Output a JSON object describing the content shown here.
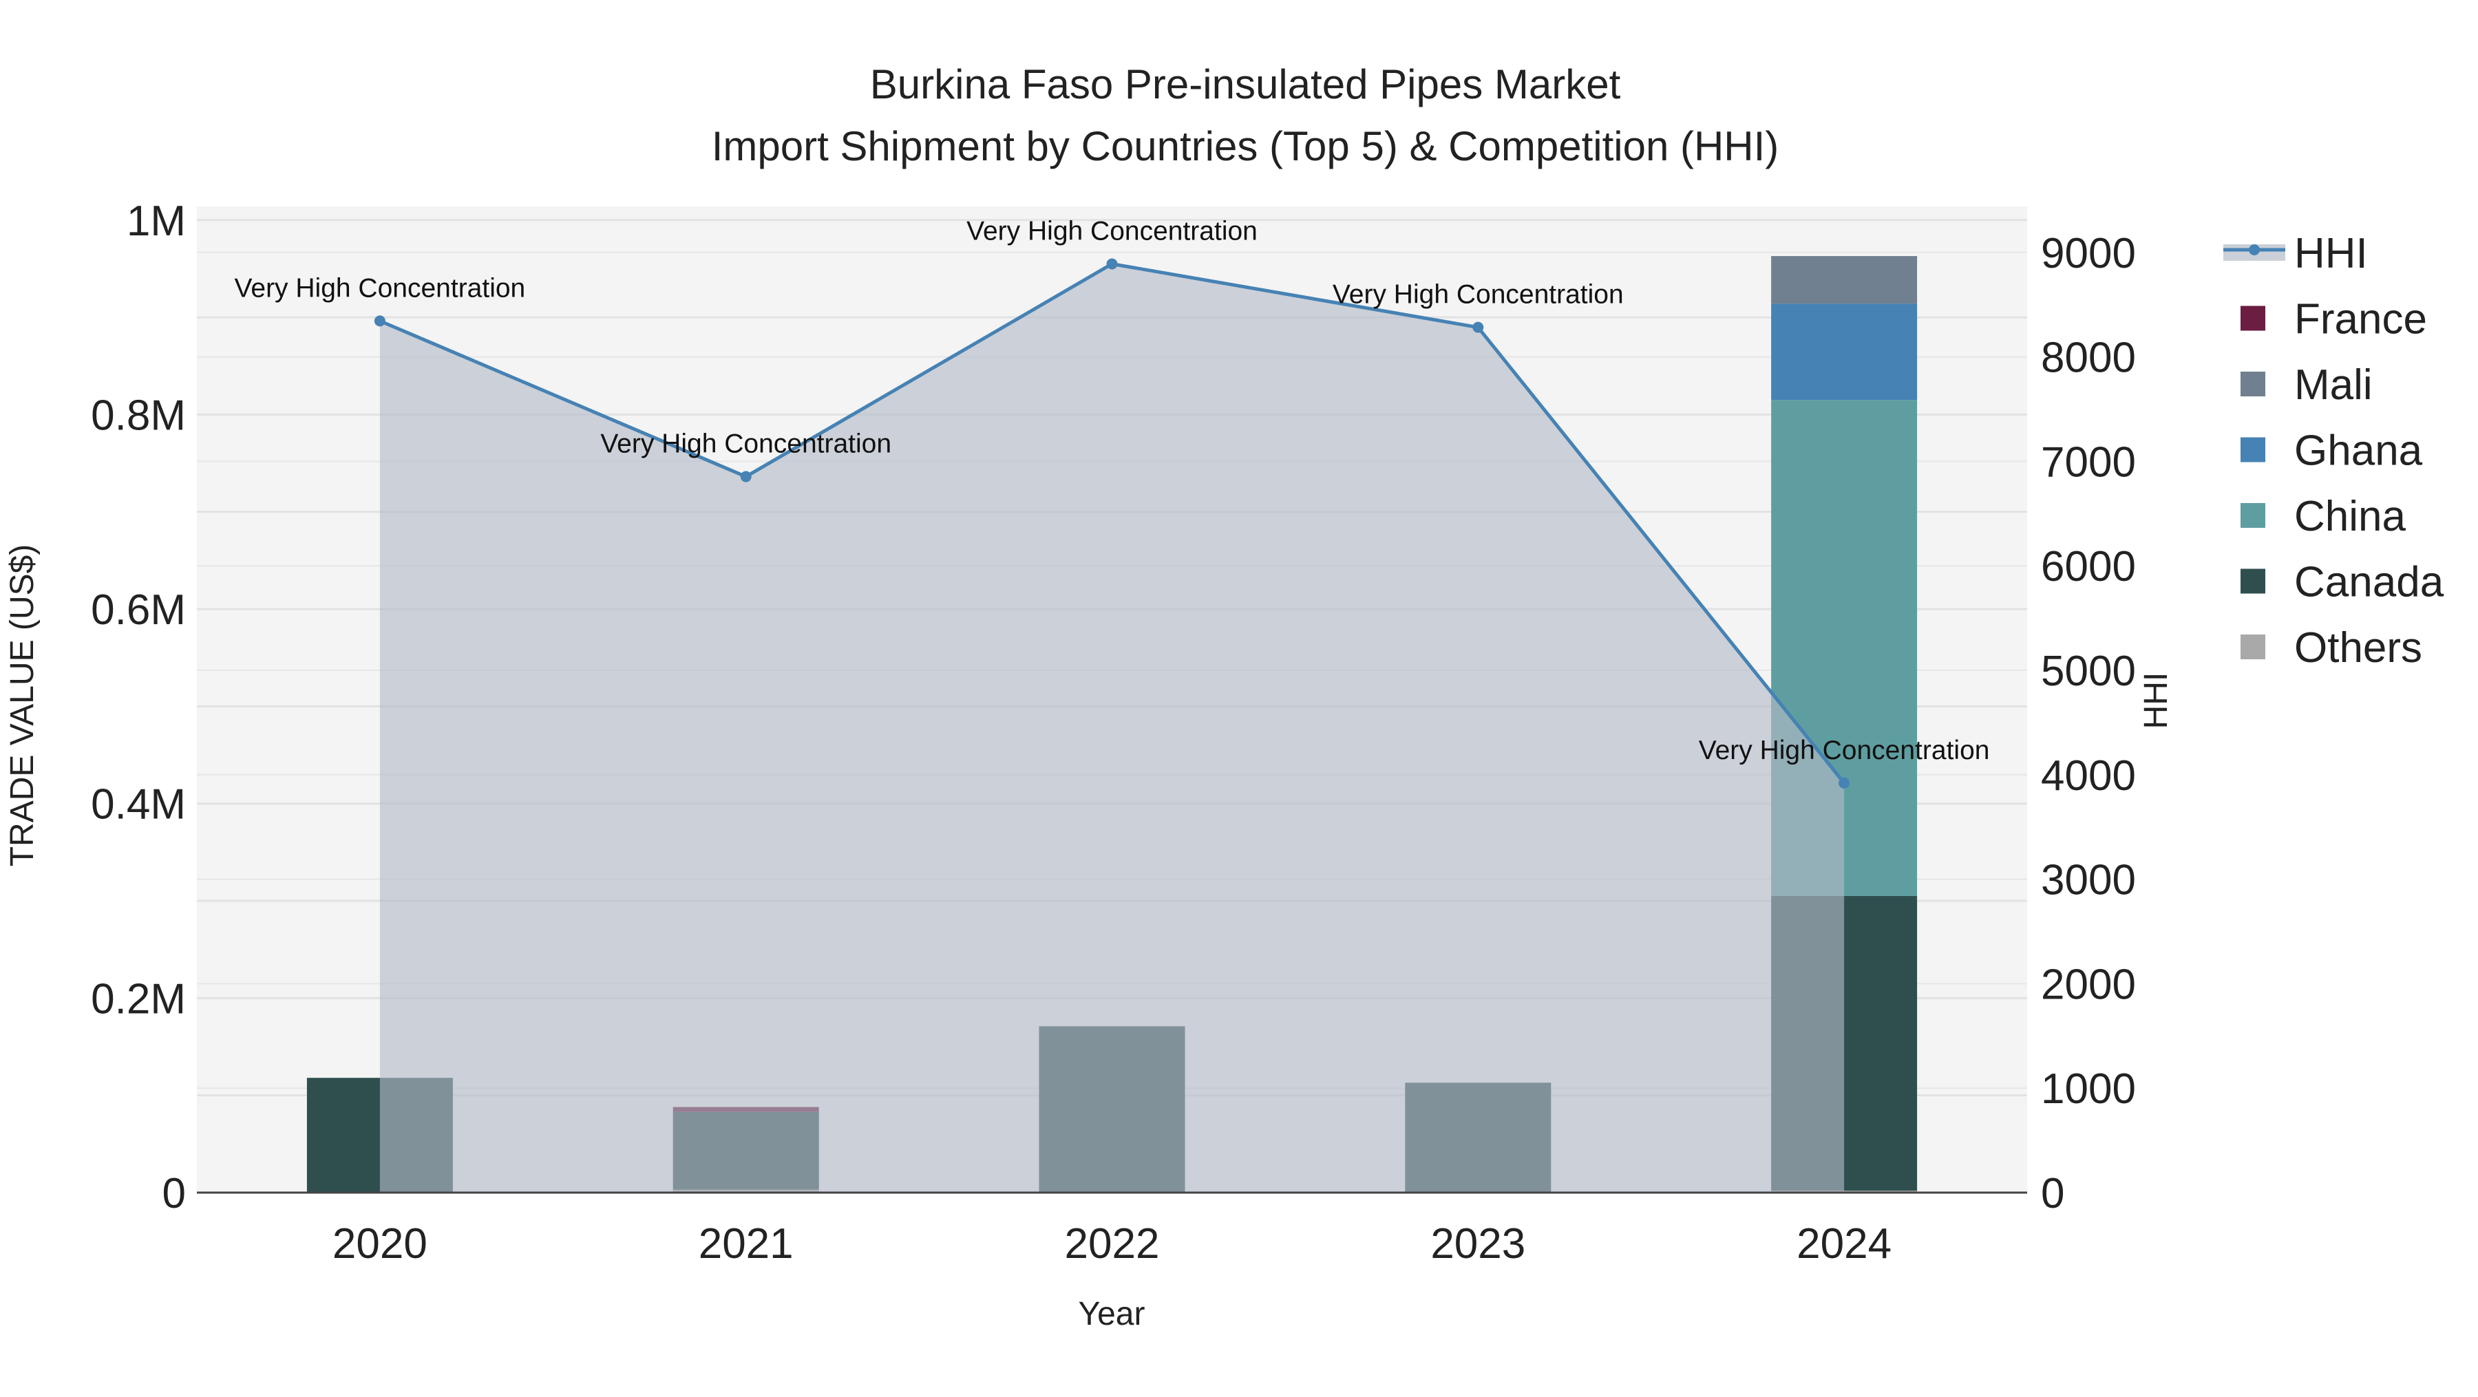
{
  "chart_data": {
    "type": "bar",
    "title_line1": "Burkina Faso Pre-insulated Pipes Market",
    "title_line2": "Import Shipment by Countries (Top 5) & Competition (HHI)",
    "xlabel": "Year",
    "ylabel": "TRADE VALUE (US$)",
    "y2label": "HHI",
    "categories": [
      "2020",
      "2021",
      "2022",
      "2023",
      "2024"
    ],
    "ylim": [
      0,
      1014000
    ],
    "y2lim": [
      0,
      9440
    ],
    "yticks": [
      {
        "v": 0,
        "label": "0"
      },
      {
        "v": 200000,
        "label": "0.2M"
      },
      {
        "v": 400000,
        "label": "0.4M"
      },
      {
        "v": 600000,
        "label": "0.6M"
      },
      {
        "v": 800000,
        "label": "0.8M"
      },
      {
        "v": 1000000,
        "label": "1M"
      }
    ],
    "y2ticks": [
      0,
      1000,
      2000,
      3000,
      4000,
      5000,
      6000,
      7000,
      8000,
      9000
    ],
    "grid": true,
    "barmode": "stack",
    "series": [
      {
        "name": "Others",
        "color": "#a9a9a9",
        "values": [
          0,
          3000,
          0,
          0,
          2000
        ]
      },
      {
        "name": "Canada",
        "color": "#2f4f4f",
        "values": [
          118000,
          80000,
          171000,
          113000,
          303000
        ]
      },
      {
        "name": "China",
        "color": "#5f9ea0",
        "values": [
          0,
          0,
          0,
          0,
          510000
        ]
      },
      {
        "name": "Ghana",
        "color": "#4682b4",
        "values": [
          0,
          0,
          0,
          0,
          99000
        ]
      },
      {
        "name": "Mali",
        "color": "#708090",
        "values": [
          0,
          0,
          0,
          0,
          49000
        ]
      },
      {
        "name": "France",
        "color": "#6b1d42",
        "values": [
          0,
          5000,
          0,
          0,
          0
        ]
      }
    ],
    "hhi": {
      "name": "HHI",
      "color": "#4682b4",
      "values": [
        8344,
        6854,
        8890,
        8283,
        3921
      ],
      "annotations": [
        "Very High Concentration",
        "Very High Concentration",
        "Very High Concentration",
        "Very High Concentration",
        "Very High Concentration"
      ]
    },
    "legend": {
      "placement": "right",
      "items": [
        {
          "name": "HHI",
          "color": "#4682b4",
          "kind": "line"
        },
        {
          "name": "France",
          "color": "#6b1d42",
          "kind": "box"
        },
        {
          "name": "Mali",
          "color": "#708090",
          "kind": "box"
        },
        {
          "name": "Ghana",
          "color": "#4682b4",
          "kind": "box"
        },
        {
          "name": "China",
          "color": "#5f9ea0",
          "kind": "box"
        },
        {
          "name": "Canada",
          "color": "#2f4f4f",
          "kind": "box"
        },
        {
          "name": "Others",
          "color": "#a9a9a9",
          "kind": "box"
        }
      ]
    }
  }
}
